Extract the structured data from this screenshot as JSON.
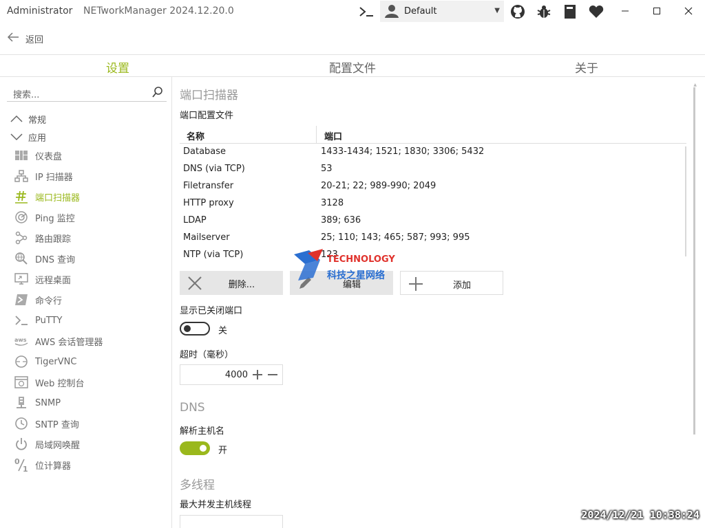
{
  "titlebar": {
    "admin_label": "Administrator",
    "app_title": "NETworkManager 2024.12.20.0",
    "profile": "Default"
  },
  "back": {
    "label": "返回"
  },
  "tabs": [
    {
      "label": "设置",
      "active": true
    },
    {
      "label": "配置文件",
      "active": false
    },
    {
      "label": "关于",
      "active": false
    }
  ],
  "sidebar": {
    "search_placeholder": "搜索...",
    "groups": [
      {
        "label": "常规"
      },
      {
        "label": "应用"
      }
    ],
    "items": [
      {
        "label": "仪表盘",
        "icon": "dashboard-icon"
      },
      {
        "label": "IP 扫描器",
        "icon": "network-icon"
      },
      {
        "label": "端口扫描器",
        "icon": "hash-icon",
        "active": true
      },
      {
        "label": "Ping 监控",
        "icon": "radar-icon"
      },
      {
        "label": "路由跟踪",
        "icon": "route-icon"
      },
      {
        "label": "DNS 查询",
        "icon": "dns-lookup-icon"
      },
      {
        "label": "远程桌面",
        "icon": "remote-desktop-icon"
      },
      {
        "label": "命令行",
        "icon": "powershell-icon"
      },
      {
        "label": "PuTTY",
        "icon": "terminal-icon"
      },
      {
        "label": "AWS 会话管理器",
        "icon": "aws-icon"
      },
      {
        "label": "TigerVNC",
        "icon": "vnc-icon"
      },
      {
        "label": "Web 控制台",
        "icon": "web-console-icon"
      },
      {
        "label": "SNMP",
        "icon": "snmp-icon"
      },
      {
        "label": "SNTP 查询",
        "icon": "clock-icon"
      },
      {
        "label": "局域网唤醒",
        "icon": "power-icon"
      },
      {
        "label": "位计算器",
        "icon": "percent-icon"
      }
    ]
  },
  "main": {
    "section_title": "端口扫描器",
    "port_profiles_label": "端口配置文件",
    "table": {
      "headers": [
        "名称",
        "端口"
      ],
      "rows": [
        [
          "Database",
          "1433-1434; 1521; 1830; 3306; 5432"
        ],
        [
          "DNS (via TCP)",
          "53"
        ],
        [
          "Filetransfer",
          "20-21; 22; 989-990; 2049"
        ],
        [
          "HTTP proxy",
          "3128"
        ],
        [
          "LDAP",
          "389; 636"
        ],
        [
          "Mailserver",
          "25; 110; 143; 465; 587; 993; 995"
        ],
        [
          "NTP (via TCP)",
          "123"
        ]
      ]
    },
    "buttons": {
      "delete": "删除...",
      "edit": "编辑",
      "add": "添加"
    },
    "show_closed": {
      "label": "显示已关闭端口",
      "state_text": "关"
    },
    "timeout": {
      "label": "超时（毫秒）",
      "value": "4000"
    },
    "dns_title": "DNS",
    "resolve": {
      "label": "解析主机名",
      "state_text": "开"
    },
    "multithread_title": "多线程",
    "max_threads_label": "最大并发主机线程"
  },
  "overlay": {
    "watermark_en": "TECHNOLOGY",
    "watermark_cn": "科技之星网络",
    "timestamp": "2024/12/21  10:38:24"
  },
  "colors": {
    "accent": "#9ab81c"
  }
}
